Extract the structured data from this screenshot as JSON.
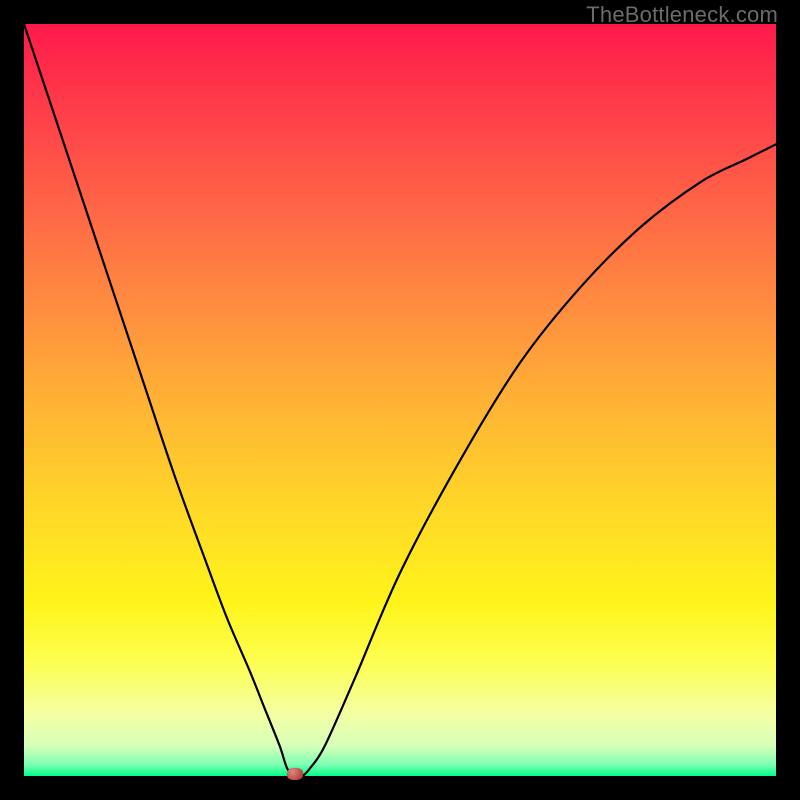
{
  "watermark": "TheBottleneck.com",
  "colors": {
    "frame": "#000000",
    "gradient_top": "#ff1a4b",
    "gradient_bottom": "#00ff88",
    "curve": "#000000",
    "marker": "#c05048"
  },
  "chart_data": {
    "type": "line",
    "title": "",
    "xlabel": "",
    "ylabel": "",
    "xlim": [
      0,
      100
    ],
    "ylim": [
      0,
      100
    ],
    "annotations": [
      {
        "name": "minimum-marker",
        "x": 36,
        "y": 0
      }
    ],
    "series": [
      {
        "name": "bottleneck-curve",
        "x": [
          0,
          4,
          8,
          12,
          16,
          20,
          24,
          27,
          30,
          32,
          34,
          35,
          36,
          37,
          38,
          40,
          44,
          50,
          58,
          66,
          74,
          82,
          90,
          96,
          100
        ],
        "values": [
          100,
          88,
          76,
          64,
          52,
          40,
          29,
          21,
          14,
          9,
          4,
          1,
          0,
          0,
          1,
          4,
          13,
          27,
          42,
          55,
          65,
          73,
          79,
          82,
          84
        ]
      }
    ]
  }
}
